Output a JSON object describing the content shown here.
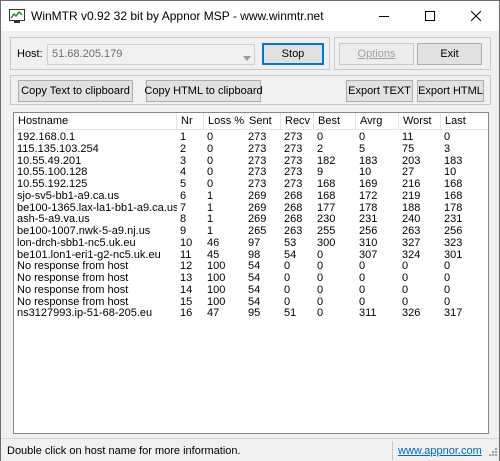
{
  "window": {
    "title": "WinMTR v0.92 32 bit by Appnor MSP - www.winmtr.net",
    "minimize_icon": "minimize-icon",
    "maximize_icon": "maximize-icon",
    "close_icon": "close-icon"
  },
  "host": {
    "label": "Host:",
    "value": "51.68.205.179"
  },
  "buttons": {
    "stop": "Stop",
    "options": "Options",
    "exit": "Exit",
    "copy_text": "Copy Text to clipboard",
    "copy_html": "Copy HTML to clipboard",
    "export_text": "Export TEXT",
    "export_html": "Export HTML"
  },
  "table": {
    "headers": [
      "Hostname",
      "Nr",
      "Loss %",
      "Sent",
      "Recv",
      "Best",
      "Avrg",
      "Worst",
      "Last"
    ],
    "rows": [
      [
        "192.168.0.1",
        "1",
        "0",
        "273",
        "273",
        "0",
        "0",
        "11",
        "0"
      ],
      [
        "115.135.103.254",
        "2",
        "0",
        "273",
        "273",
        "2",
        "5",
        "75",
        "3"
      ],
      [
        "10.55.49.201",
        "3",
        "0",
        "273",
        "273",
        "182",
        "183",
        "203",
        "183"
      ],
      [
        "10.55.100.128",
        "4",
        "0",
        "273",
        "273",
        "9",
        "10",
        "27",
        "10"
      ],
      [
        "10.55.192.125",
        "5",
        "0",
        "273",
        "273",
        "168",
        "169",
        "216",
        "168"
      ],
      [
        "sjo-sv5-bb1-a9.ca.us",
        "6",
        "1",
        "269",
        "268",
        "168",
        "172",
        "219",
        "168"
      ],
      [
        "be100-1365.lax-la1-bb1-a9.ca.us",
        "7",
        "1",
        "269",
        "268",
        "177",
        "178",
        "188",
        "178"
      ],
      [
        "ash-5-a9.va.us",
        "8",
        "1",
        "269",
        "268",
        "230",
        "231",
        "240",
        "231"
      ],
      [
        "be100-1007.nwk-5-a9.nj.us",
        "9",
        "1",
        "265",
        "263",
        "255",
        "256",
        "263",
        "256"
      ],
      [
        "lon-drch-sbb1-nc5.uk.eu",
        "10",
        "46",
        "97",
        "53",
        "300",
        "310",
        "327",
        "323"
      ],
      [
        "be101.lon1-eri1-g2-nc5.uk.eu",
        "11",
        "45",
        "98",
        "54",
        "0",
        "307",
        "324",
        "301"
      ],
      [
        "No response from host",
        "12",
        "100",
        "54",
        "0",
        "0",
        "0",
        "0",
        "0"
      ],
      [
        "No response from host",
        "13",
        "100",
        "54",
        "0",
        "0",
        "0",
        "0",
        "0"
      ],
      [
        "No response from host",
        "14",
        "100",
        "54",
        "0",
        "0",
        "0",
        "0",
        "0"
      ],
      [
        "No response from host",
        "15",
        "100",
        "54",
        "0",
        "0",
        "0",
        "0",
        "0"
      ],
      [
        "ns3127993.ip-51-68-205.eu",
        "16",
        "47",
        "95",
        "51",
        "0",
        "311",
        "326",
        "317"
      ]
    ]
  },
  "status": {
    "text": "Double click on host name for more information.",
    "link": "www.appnor.com"
  }
}
